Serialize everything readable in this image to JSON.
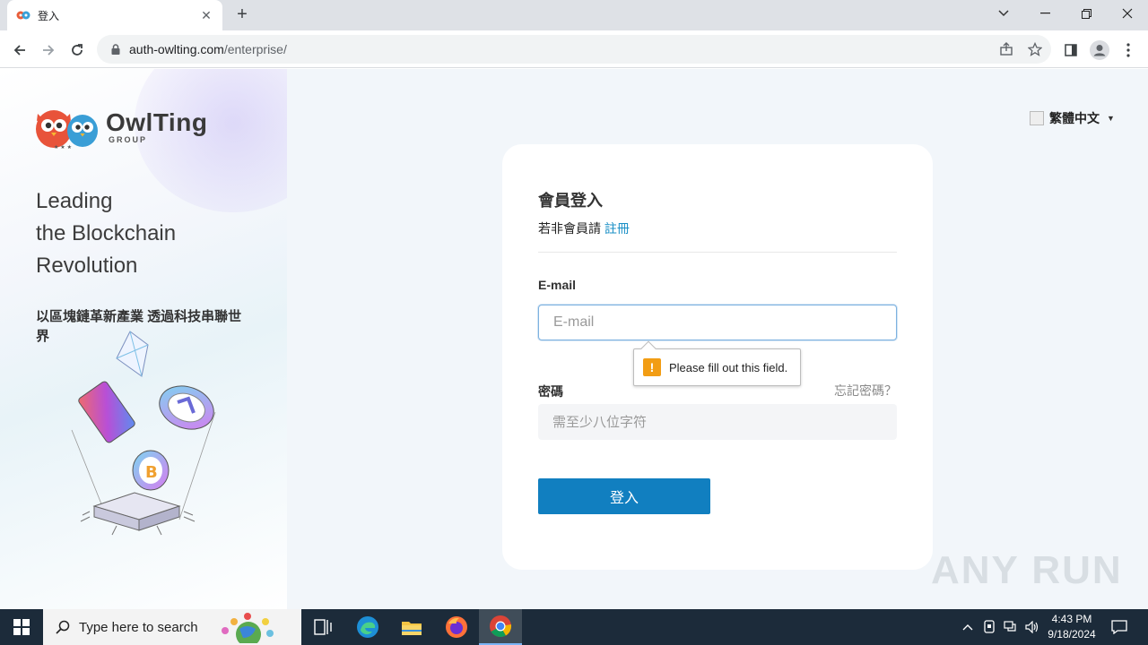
{
  "browser": {
    "tab_title": "登入",
    "url_host": "auth-owlting.com",
    "url_path": "/enterprise/"
  },
  "logo": {
    "name": "OwlTing",
    "sub": "GROUP"
  },
  "left": {
    "headline": [
      "Leading",
      "the Blockchain",
      "Revolution"
    ],
    "subline": "以區塊鏈革新產業 透過科技串聯世界"
  },
  "language": {
    "selected": "繁體中文"
  },
  "login": {
    "title": "會員登入",
    "register_prompt": "若非會員請",
    "register_link": "註冊",
    "email_label": "E-mail",
    "email_placeholder": "E-mail",
    "password_label": "密碼",
    "forgot_label": "忘記密碼？",
    "password_placeholder": "需至少八位字符",
    "submit_label": "登入"
  },
  "validation": {
    "message": "Please fill out this field."
  },
  "watermark": "ANY RUN",
  "taskbar": {
    "search_placeholder": "Type here to search",
    "time": "4:43 PM",
    "date": "9/18/2024"
  },
  "colors": {
    "accent": "#117fc0",
    "link": "#1a8fc6",
    "warning": "#f29d14",
    "taskbar": "#1c2b3a"
  }
}
